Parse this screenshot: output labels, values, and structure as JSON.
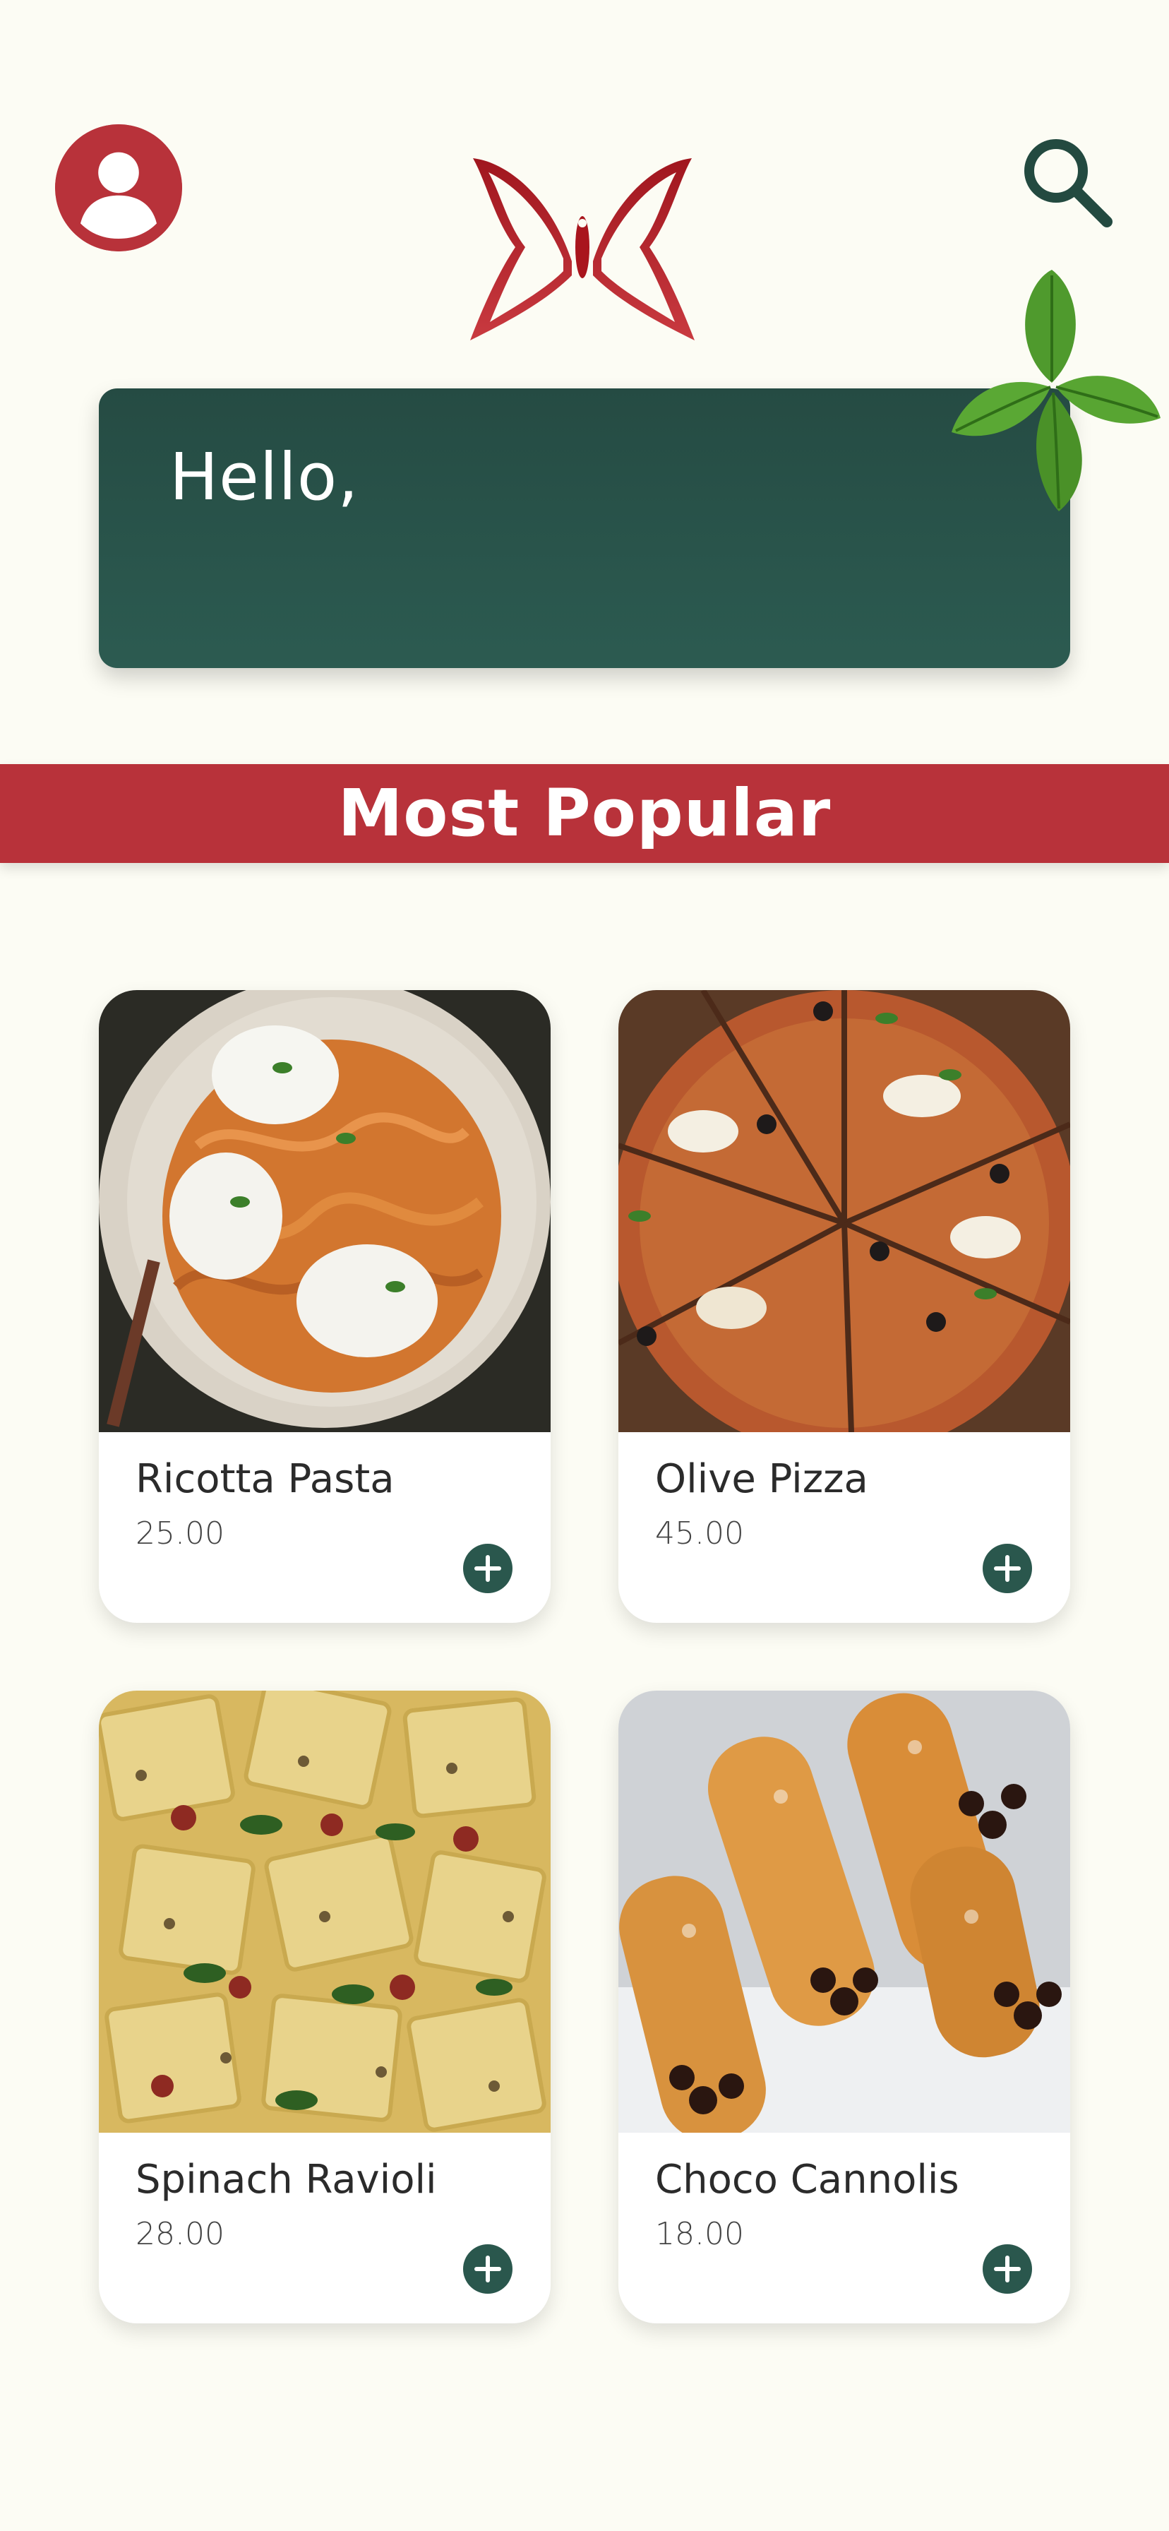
{
  "header": {
    "profile_icon": "user-icon",
    "logo_icon": "butterfly-logo",
    "search_icon": "search-icon"
  },
  "greeting": {
    "text": "Hello,"
  },
  "section": {
    "title": "Most Popular"
  },
  "products": [
    {
      "name": "Ricotta Pasta",
      "price": "25.00",
      "image": "ricotta-pasta-photo"
    },
    {
      "name": "Olive Pizza",
      "price": "45.00",
      "image": "olive-pizza-photo"
    },
    {
      "name": "Spinach Ravioli",
      "price": "28.00",
      "image": "spinach-ravioli-photo"
    },
    {
      "name": "Choco Cannolis",
      "price": "18.00",
      "image": "choco-cannolis-photo"
    }
  ],
  "colors": {
    "background": "#fcfcf4",
    "accent_red": "#b8323a",
    "accent_green": "#2a574d"
  }
}
